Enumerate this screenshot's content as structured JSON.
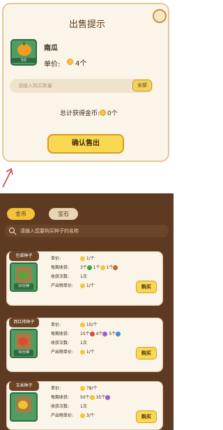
{
  "sell_dialog": {
    "title": "出售提示",
    "item": {
      "name": "南瓜",
      "count": "50"
    },
    "price_label": "单价:",
    "price_value": "4个",
    "input_placeholder": "请输入购买数量",
    "all_button": "全部",
    "total_label": "总计获得金币:",
    "total_value": "0个",
    "confirm_button": "确认售出"
  },
  "shop": {
    "tabs": [
      "金币",
      "宝石"
    ],
    "search_placeholder": "请输入您要购买种子的名称",
    "buy_label": "购买",
    "seeds": [
      {
        "name": "包菜种子",
        "time": "10分钟",
        "price_label": "单价:",
        "price_value": "1/个",
        "yield_label": "每期收获:",
        "yield_items": [
          "3个",
          "1个",
          "1个"
        ],
        "harvest_count_label": "收获次数:",
        "harvest_count": "1次",
        "produce_price_label": "产出物单价:",
        "produce_price": "1/个"
      },
      {
        "name": "西红柿种子",
        "time": "30分钟",
        "price_label": "单价:",
        "price_value": "10/个",
        "yield_label": "每期收获:",
        "yield_items": [
          "15个",
          "4个",
          "5个"
        ],
        "harvest_count_label": "收获次数:",
        "harvest_count": "1次",
        "produce_price_label": "产出物单价:",
        "produce_price": "1/个"
      },
      {
        "name": "玉米种子",
        "time": "",
        "price_label": "单价:",
        "price_value": "78/个",
        "yield_label": "每期收获:",
        "yield_items": [
          "50个",
          "35个"
        ],
        "harvest_count_label": "收获次数:",
        "harvest_count": "1次",
        "produce_price_label": "产出物单价:",
        "produce_price": "3/个"
      }
    ]
  },
  "colors": {
    "coin": "#f7c534",
    "button": "#f9d852",
    "shop_bg": "#5e3a22",
    "panel_bg": "#fbf4e8"
  }
}
